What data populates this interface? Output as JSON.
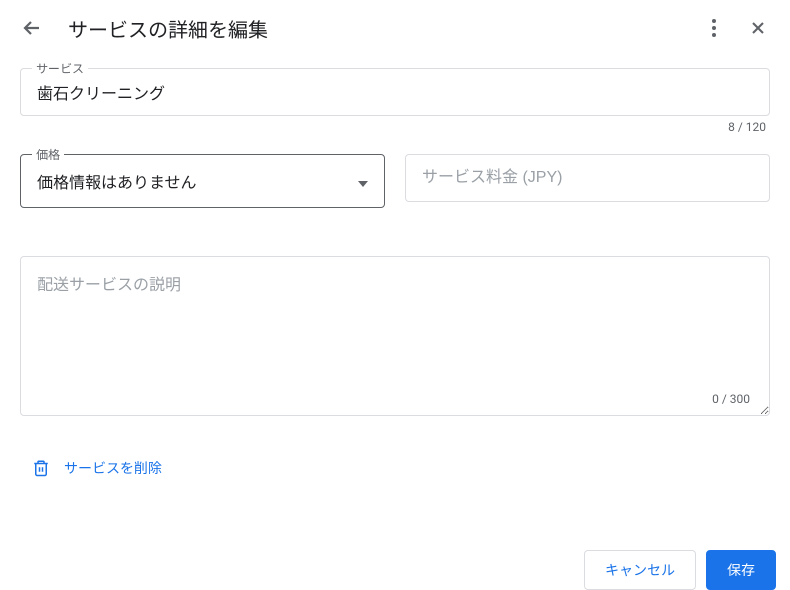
{
  "header": {
    "title": "サービスの詳細を編集"
  },
  "service": {
    "label": "サービス",
    "value": "歯石クリーニング",
    "counter": "8 / 120"
  },
  "price": {
    "label": "価格",
    "selected": "価格情報はありません"
  },
  "fee": {
    "placeholder": "サービス料金 (JPY)"
  },
  "description": {
    "placeholder": "配送サービスの説明",
    "counter": "0 / 300"
  },
  "actions": {
    "delete": "サービスを削除",
    "cancel": "キャンセル",
    "save": "保存"
  }
}
